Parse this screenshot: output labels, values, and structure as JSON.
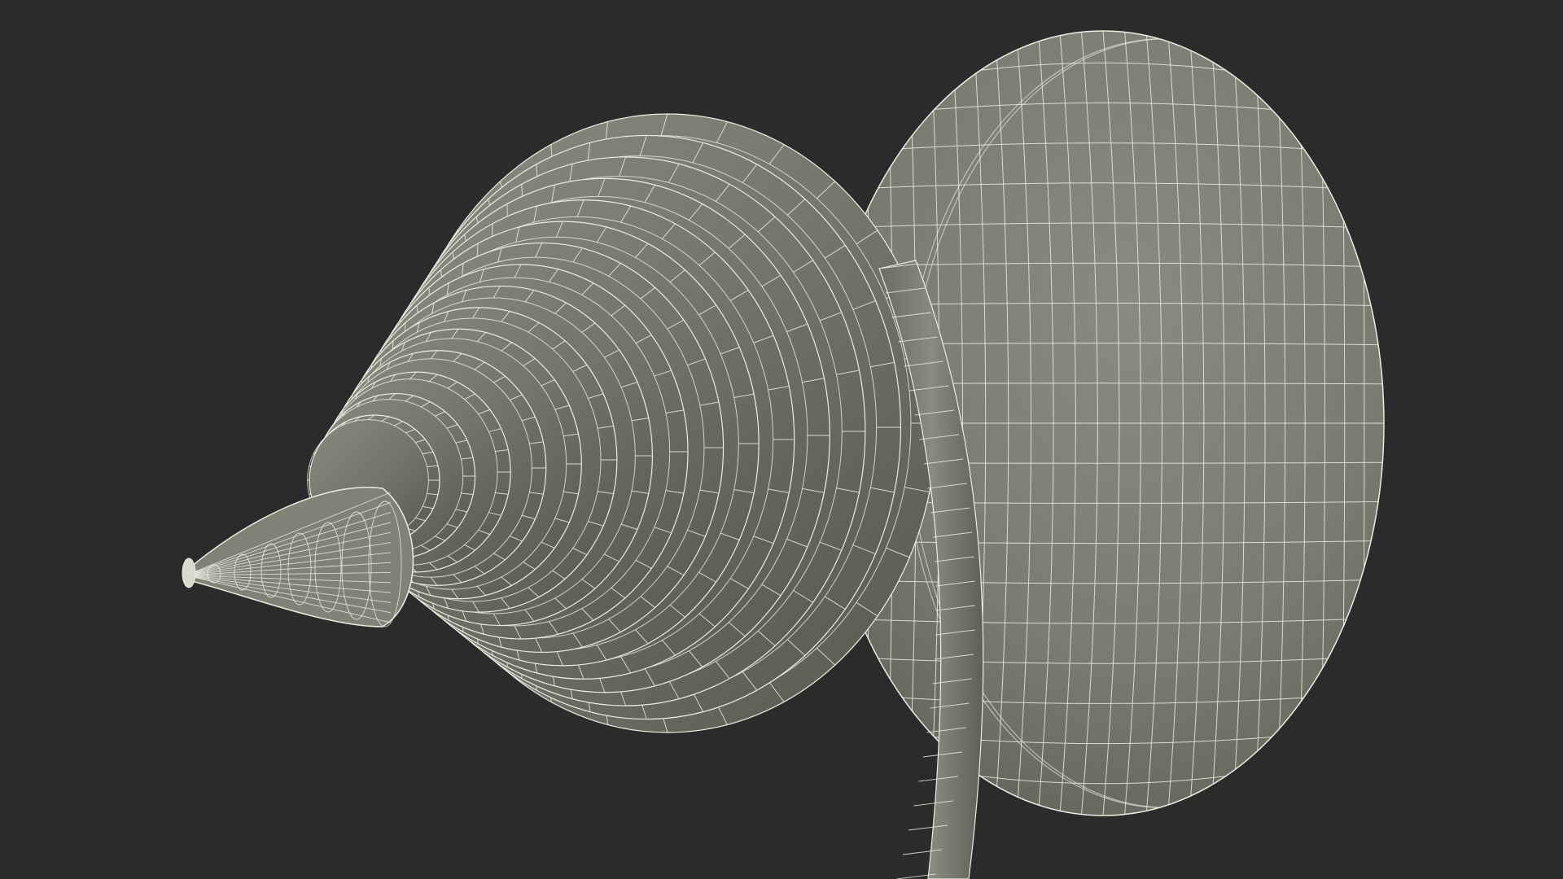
{
  "scene": {
    "subject": "wireframe-mesh-model",
    "colors": {
      "background": "#2b2b2b",
      "surface": "#7b7c71",
      "surface_dark": "#55564d",
      "surface_light": "#8a8b80",
      "wire": "#ecece4"
    },
    "tool_rings": 15
  }
}
